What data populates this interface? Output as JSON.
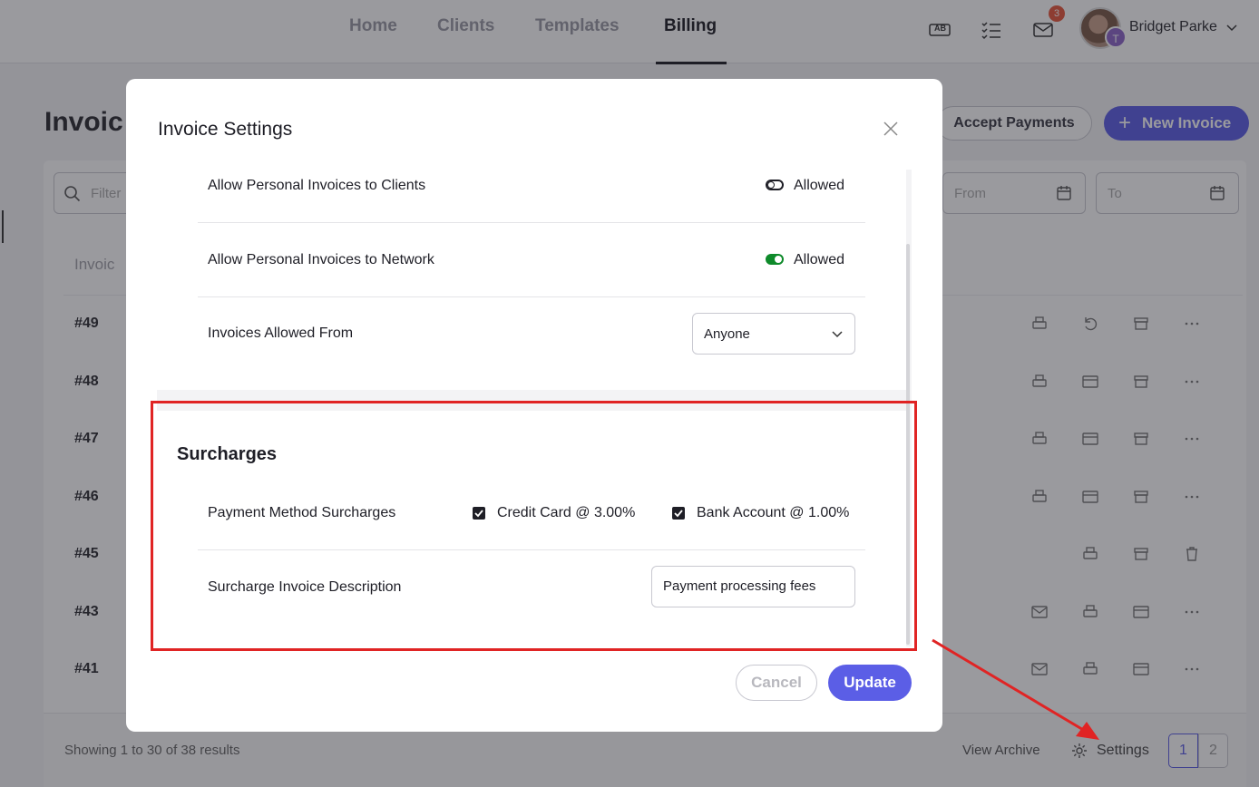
{
  "nav": {
    "tabs": [
      {
        "label": "Home"
      },
      {
        "label": "Clients"
      },
      {
        "label": "Templates"
      },
      {
        "label": "Billing"
      }
    ],
    "ab_icon_text": "AB",
    "mail_badge": "3",
    "avatar_initial": "T",
    "user_name": "Bridget Parke"
  },
  "page": {
    "title": "Invoic",
    "accept_payments": "Accept Payments",
    "new_invoice": "New Invoice",
    "filter_placeholder": "Filter",
    "from_placeholder": "From",
    "to_placeholder": "To",
    "column_header": "Invoic",
    "rows": [
      "#49",
      "#48",
      "#47",
      "#46",
      "#45",
      "#43",
      "#41"
    ],
    "showing": "Showing 1 to 30 of 38 results",
    "view_archive": "View Archive",
    "settings": "Settings",
    "pages": [
      "1",
      "2"
    ]
  },
  "modal": {
    "title": "Invoice Settings",
    "general": {
      "rows": [
        {
          "label": "Allow Personal Invoices to Clients",
          "toggle_on": false,
          "status": "Allowed"
        },
        {
          "label": "Allow Personal Invoices to Network",
          "toggle_on": true,
          "status": "Allowed"
        }
      ],
      "allowed_from_label": "Invoices Allowed From",
      "allowed_from_value": "Anyone"
    },
    "surcharges": {
      "title": "Surcharges",
      "method_label": "Payment Method Surcharges",
      "credit_card": "Credit Card @ 3.00%",
      "credit_card_checked": true,
      "bank_account": "Bank Account @ 1.00%",
      "bank_account_checked": true,
      "description_label": "Surcharge Invoice Description",
      "description_value": "Payment processing fees"
    },
    "cancel": "Cancel",
    "update": "Update"
  },
  "colors": {
    "accent": "#5b5ee6",
    "toggle_on": "#0e8a2a",
    "highlight": "#e02424",
    "badge": "#e8573b"
  }
}
